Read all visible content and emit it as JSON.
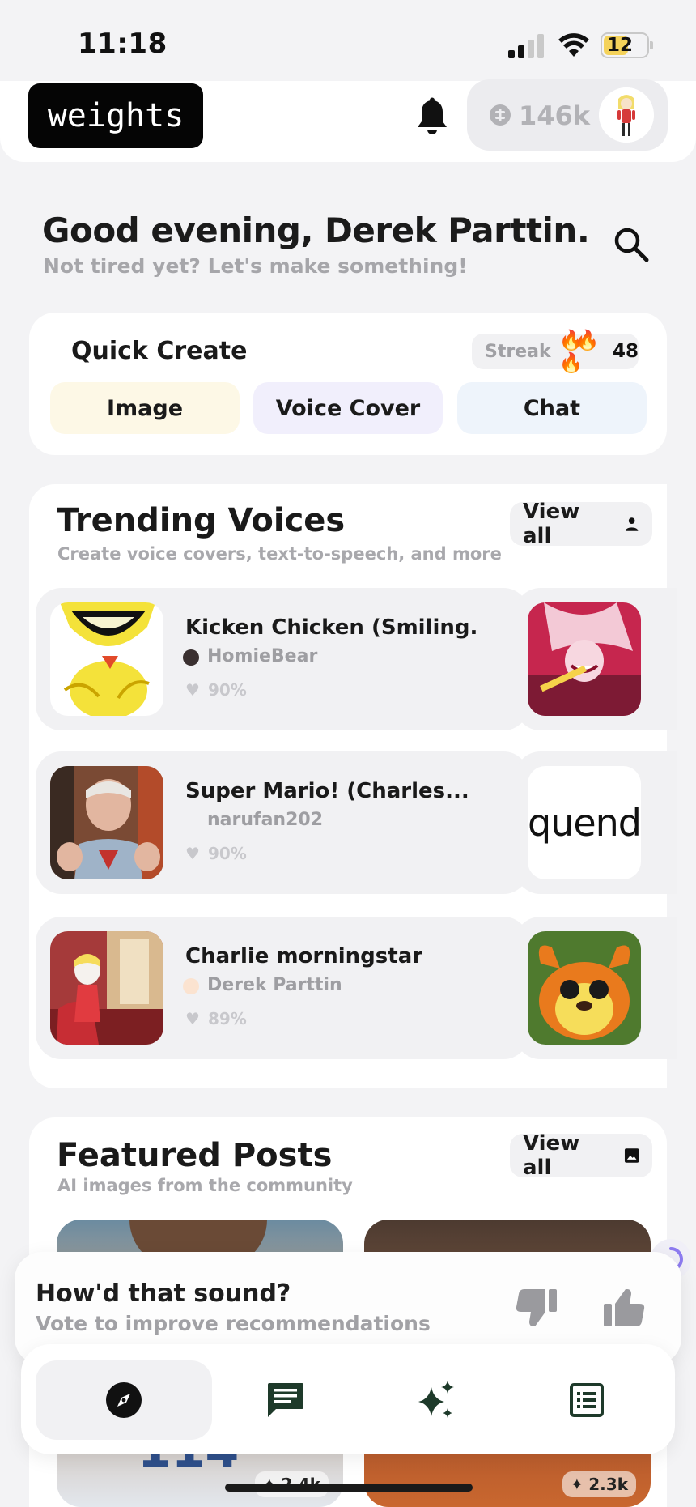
{
  "status_bar": {
    "time": "11:18",
    "battery": "12"
  },
  "header": {
    "logo": "weights",
    "credits": "146k"
  },
  "greeting": {
    "title": "Good evening, Derek Parttin.",
    "subtitle": "Not tired yet? Let's make something!"
  },
  "quick_create": {
    "title": "Quick Create",
    "streak_label": "Streak",
    "streak_icon": "🔥🔥🔥",
    "streak_count": "48",
    "buttons": {
      "image": "Image",
      "voice_cover": "Voice Cover",
      "chat": "Chat"
    }
  },
  "trending": {
    "title": "Trending Voices",
    "subtitle": "Create voice covers, text-to-speech, and more",
    "view_all": "View all",
    "voices": [
      {
        "name": "Kicken Chicken (Smiling...",
        "author": "HomieBear",
        "rating": "90%"
      },
      {
        "name": "Super Mario! (Charles...",
        "author": "narufan202",
        "rating": "90%"
      },
      {
        "name": "Charlie morningstar",
        "author": "Derek Parttin",
        "rating": "89%"
      }
    ],
    "peek_logo_text": "quend"
  },
  "featured": {
    "title": "Featured Posts",
    "subtitle": "AI images from the community",
    "view_all": "View all",
    "posts": [
      {
        "count": "2.4k",
        "jersey": "114"
      },
      {
        "count": "2.3k"
      }
    ]
  },
  "feedback": {
    "title": "How'd that sound?",
    "subtitle": "Vote to improve recommendations"
  },
  "tabs": [
    "explore-icon",
    "chat-icon",
    "create-sparkle-icon",
    "library-icon"
  ],
  "colors": {
    "background": "#f3f3f5",
    "logo_bg": "#050505",
    "image_btn": "#fdf8e6",
    "voice_btn": "#f1effc",
    "chat_btn": "#eef4fb",
    "tab_icon": "#1e3a2a"
  }
}
